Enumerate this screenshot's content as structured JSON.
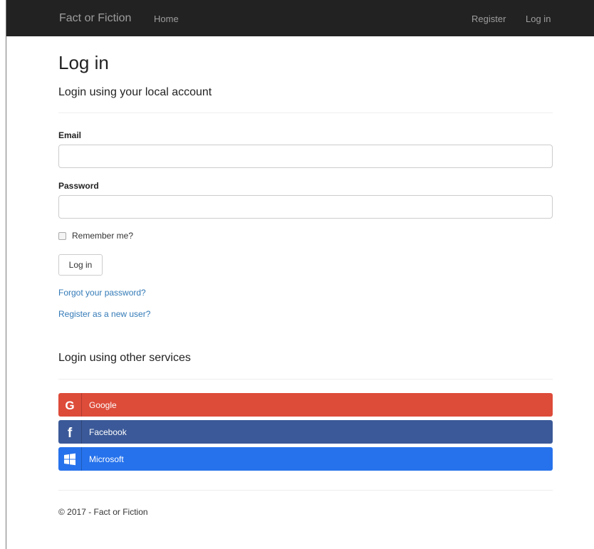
{
  "navbar": {
    "brand": "Fact or Fiction",
    "home": "Home",
    "register": "Register",
    "login": "Log in"
  },
  "page": {
    "title": "Log in",
    "local_heading": "Login using your local account",
    "email_label": "Email",
    "email_value": "",
    "password_label": "Password",
    "password_value": "",
    "remember_label": "Remember me?",
    "remember_checked": false,
    "login_button": "Log in",
    "forgot_link": "Forgot your password?",
    "register_link": "Register as a new user?",
    "external_heading": "Login using other services"
  },
  "providers": [
    {
      "label": "Google",
      "icon": "google-icon",
      "color": "#dd4b39"
    },
    {
      "label": "Facebook",
      "icon": "facebook-icon",
      "color": "#3b5998"
    },
    {
      "label": "Microsoft",
      "icon": "windows-icon",
      "color": "#2672ec"
    }
  ],
  "footer": {
    "text": "© 2017 - Fact or Fiction"
  }
}
